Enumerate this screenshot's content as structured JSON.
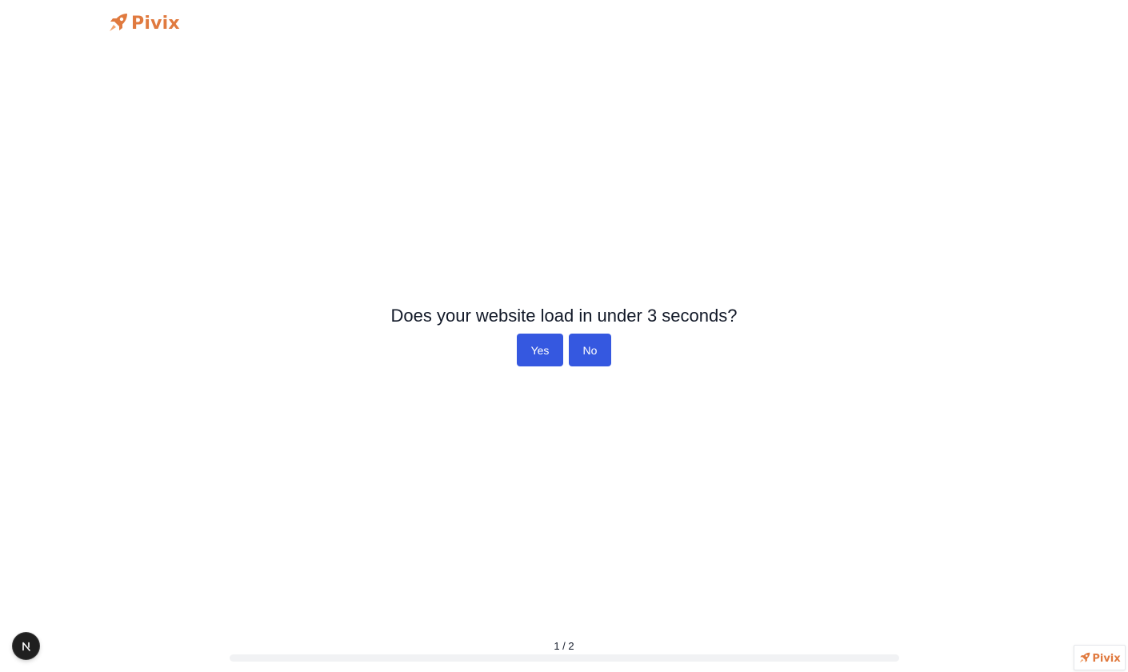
{
  "brand": {
    "name": "Pivix",
    "color": "#e07a3f",
    "icon": "rocket-icon"
  },
  "quiz": {
    "question": "Does your website load in under 3 seconds?",
    "answers": [
      {
        "label": "Yes"
      },
      {
        "label": "No"
      }
    ],
    "button_color": "#3558e0"
  },
  "progress": {
    "label": "1 / 2",
    "current": 1,
    "total": 2,
    "fill_fraction": 0
  },
  "dev_indicator": {
    "letter": "N",
    "icon": "nextjs-icon"
  },
  "badge": {
    "name": "Pivix",
    "icon": "rocket-icon"
  }
}
